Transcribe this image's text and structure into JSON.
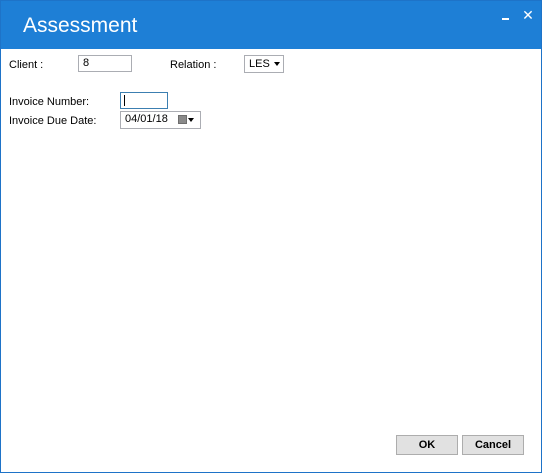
{
  "window": {
    "title": "Assessment",
    "close_glyph": "✕"
  },
  "form": {
    "client_label": "Client :",
    "client_value": "8",
    "relation_label": "Relation :",
    "relation_value": "LES",
    "invoice_number_label": "Invoice Number:",
    "invoice_number_value": "",
    "invoice_due_date_label": "Invoice Due Date:",
    "invoice_due_date_value": "04/01/18"
  },
  "buttons": {
    "ok": "OK",
    "cancel": "Cancel"
  },
  "icons": {
    "minimize": "minimize-icon",
    "close": "close-icon",
    "dropdown": "chevron-down-icon",
    "calendar": "calendar-icon"
  },
  "colors": {
    "titlebar": "#1e7fd6",
    "border": "#1e73c8"
  }
}
